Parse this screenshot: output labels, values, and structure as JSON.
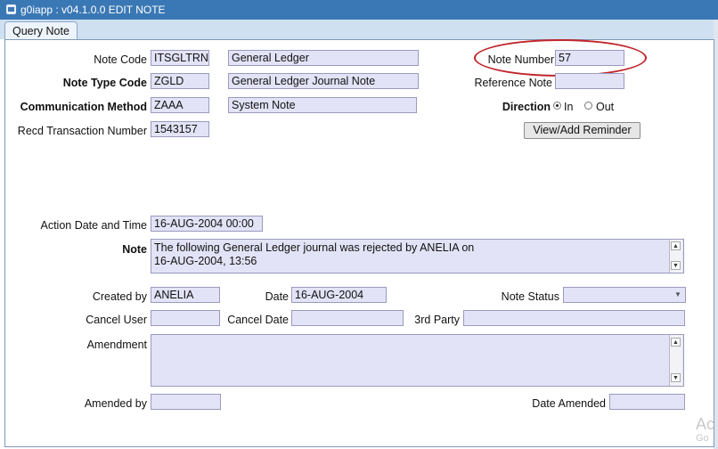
{
  "window": {
    "title": "g0iapp : v04.1.0.0 EDIT NOTE"
  },
  "tabs": [
    {
      "label": "Query Note"
    }
  ],
  "form": {
    "note_code": {
      "label": "Note Code",
      "value": "ITSGLTRN",
      "description": "General Ledger"
    },
    "note_type_code": {
      "label": "Note Type Code",
      "value": "ZGLD",
      "description": "General Ledger Journal  Note"
    },
    "communication_method": {
      "label": "Communication Method",
      "value": "ZAAA",
      "description": "System Note"
    },
    "recd_transaction_number": {
      "label": "Recd Transaction Number",
      "value": "1543157"
    },
    "note_number": {
      "label": "Note Number",
      "value": "57"
    },
    "reference_note": {
      "label": "Reference Note",
      "value": ""
    },
    "direction": {
      "label": "Direction",
      "options": [
        "In",
        "Out"
      ],
      "selected": "In"
    },
    "view_add_reminder": {
      "label": "View/Add Reminder"
    },
    "action_date_time": {
      "label": "Action Date and Time",
      "value": "16-AUG-2004 00:00"
    },
    "note": {
      "label": "Note",
      "line1": "The following General Ledger journal was rejected by ANELIA on",
      "line2": "16-AUG-2004, 13:56"
    },
    "created_by": {
      "label": "Created by",
      "value": "ANELIA"
    },
    "date": {
      "label": "Date",
      "value": "16-AUG-2004"
    },
    "note_status": {
      "label": "Note Status",
      "value": ""
    },
    "cancel_user": {
      "label": "Cancel User",
      "value": ""
    },
    "cancel_date": {
      "label": "Cancel Date",
      "value": ""
    },
    "third_party": {
      "label": "3rd Party",
      "value": ""
    },
    "amendment": {
      "label": "Amendment",
      "value": ""
    },
    "amended_by": {
      "label": "Amended by",
      "value": ""
    },
    "date_amended": {
      "label": "Date Amended",
      "value": ""
    }
  },
  "watermark": {
    "line1": "Ac",
    "line2": "Go"
  },
  "colors": {
    "titlebar": "#3a78b5",
    "field_bg": "#e3e3f7",
    "highlight_oval": "#c0262d"
  },
  "icons": {
    "app": "app-window-icon",
    "scroll_up": "arrow-up-icon",
    "scroll_down": "arrow-down-icon",
    "dropdown": "chevron-down-icon"
  }
}
